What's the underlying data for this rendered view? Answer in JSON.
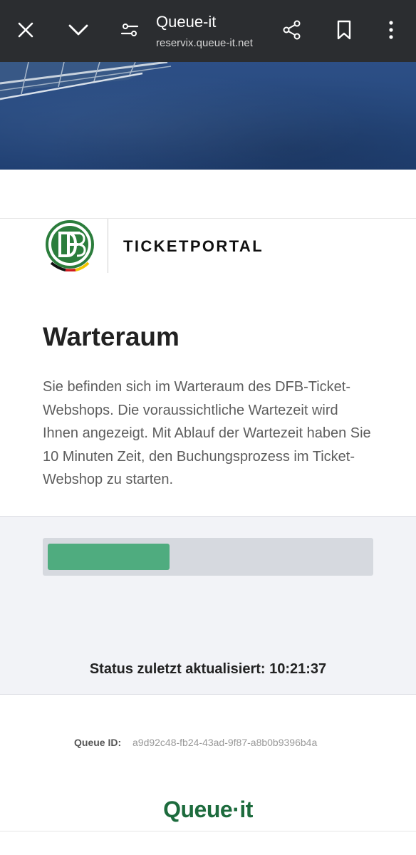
{
  "browser": {
    "title": "Queue-it",
    "url": "reservix.queue-it.net"
  },
  "header": {
    "portal_label": "TICKETPORTAL"
  },
  "main": {
    "heading": "Warteraum",
    "intro": "Sie befinden sich im Warteraum des DFB-Ticket-Webshops. Die voraussichtliche Wartezeit wird Ihnen angezeigt. Mit Ablauf der Wartezeit haben Sie 10 Minuten Zeit, den Buchungsprozess im Ticket-Webshop zu starten."
  },
  "queue": {
    "progress_fraction": 0.38,
    "status": "Status zuletzt aktualisiert: 10:21:37",
    "id_label": "Queue ID:",
    "id_value": "a9d92c48-fb24-43ad-9f87-a8b0b9396b4a"
  },
  "footer": {
    "brand": "Queue·it"
  },
  "colors": {
    "topbar": "#2b2d30",
    "progress_fill": "#4fac7f",
    "progress_track": "#d6d9df",
    "brand_green": "#1d6b3d",
    "dfb_green": "#2b7d3c"
  },
  "icons": {
    "close": "close-icon",
    "collapse": "chevron-down-icon",
    "site_settings": "tune-icon",
    "share": "share-icon",
    "bookmark": "bookmark-icon",
    "more": "more-vert-icon"
  }
}
